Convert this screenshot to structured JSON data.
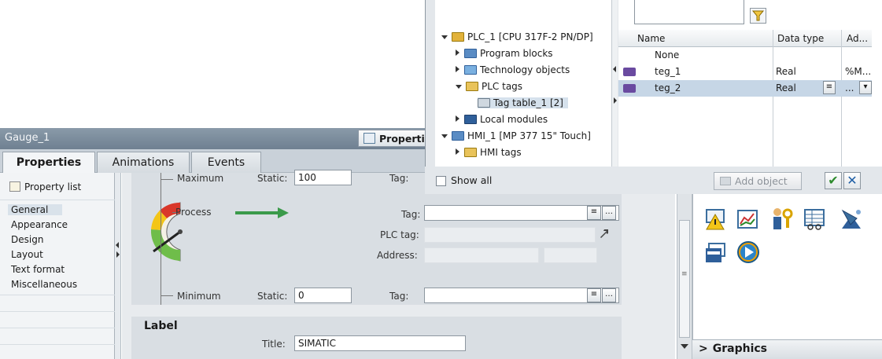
{
  "window": {
    "title": "Gauge_1",
    "properties_button": "Properti"
  },
  "tabs": [
    {
      "label": "Properties",
      "active": true
    },
    {
      "label": "Animations",
      "active": false
    },
    {
      "label": "Events",
      "active": false
    }
  ],
  "nav": {
    "property_list": "Property list",
    "items": [
      {
        "label": "General",
        "selected": true
      },
      {
        "label": "Appearance",
        "selected": false
      },
      {
        "label": "Design",
        "selected": false
      },
      {
        "label": "Layout",
        "selected": false
      },
      {
        "label": "Text format",
        "selected": false
      },
      {
        "label": "Miscellaneous",
        "selected": false
      }
    ]
  },
  "gauge": {
    "maximum": {
      "label": "Maximum",
      "static_label": "Static:",
      "static_value": "100",
      "tag_label": "Tag:"
    },
    "process": {
      "label": "Process",
      "tag_label": "Tag:",
      "plc_tag_label": "PLC tag:",
      "address_label": "Address:"
    },
    "minimum": {
      "label": "Minimum",
      "static_label": "Static:",
      "static_value": "0",
      "tag_label": "Tag:"
    }
  },
  "label_section": {
    "heading": "Label",
    "title_label": "Title:",
    "title_value": "SIMATIC"
  },
  "toolbox": {
    "section": "Graphics"
  },
  "popup": {
    "tree": [
      {
        "label": "PLC_1 [CPU 317F-2 PN/DP]",
        "expanded": true,
        "level": 0
      },
      {
        "label": "Program blocks",
        "expanded": false,
        "level": 1
      },
      {
        "label": "Technology objects",
        "expanded": false,
        "level": 1
      },
      {
        "label": "PLC tags",
        "expanded": true,
        "level": 1
      },
      {
        "label": "Tag table_1 [2]",
        "level": 2
      },
      {
        "label": "Local modules",
        "expanded": false,
        "level": 1
      },
      {
        "label": "HMI_1 [MP 377 15\" Touch]",
        "expanded": true,
        "level": 0
      },
      {
        "label": "HMI tags",
        "expanded": false,
        "level": 1
      }
    ],
    "columns": [
      "Name",
      "Data type",
      "Ad..."
    ],
    "rows": [
      {
        "name": "None",
        "type": "",
        "addr": ""
      },
      {
        "name": "teg_1",
        "type": "Real",
        "addr": "%M..."
      },
      {
        "name": "teg_2",
        "type": "Real",
        "addr": "..."
      }
    ],
    "show_all": "Show all",
    "add_object": "Add object"
  },
  "colors": {
    "titlebar": "#7f8f9e",
    "selected_row": "#c6d6e6",
    "arrow": "#3a9a4a",
    "ok": "#2e8b2e",
    "cancel": "#1f5fa5"
  }
}
